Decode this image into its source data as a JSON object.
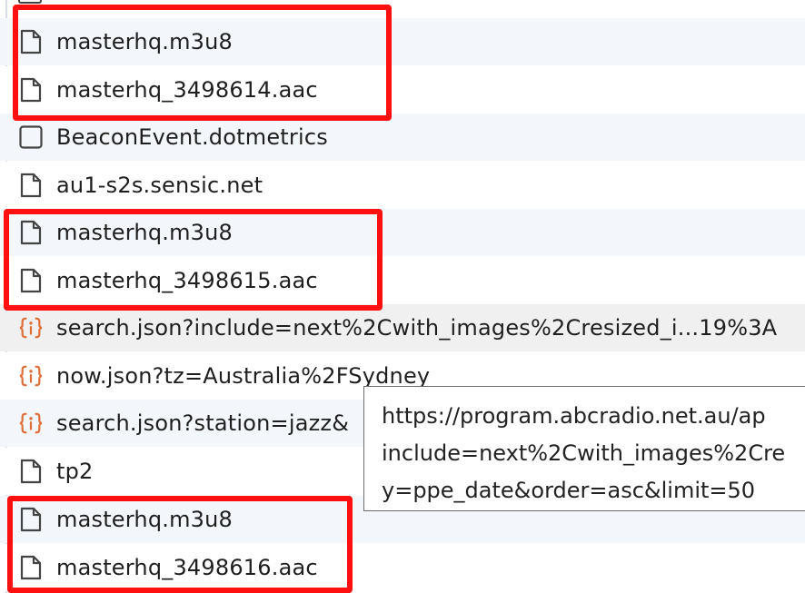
{
  "accent_color": "#ff1010",
  "icon_colors": {
    "file": "#444444",
    "json": "#e0703a"
  },
  "requests": [
    {
      "name": "masterhq.m3u8",
      "icon": "file-icon"
    },
    {
      "name": "masterhq_3498614.aac",
      "icon": "file-icon"
    },
    {
      "name": "BeaconEvent.dotmetrics",
      "icon": "checkbox-icon"
    },
    {
      "name": "au1-s2s.sensic.net",
      "icon": "file-icon"
    },
    {
      "name": "masterhq.m3u8",
      "icon": "file-icon"
    },
    {
      "name": "masterhq_3498615.aac",
      "icon": "file-icon"
    },
    {
      "name": "search.json?include=next%2Cwith_images%2Cresized_i...19%3A",
      "icon": "json-icon"
    },
    {
      "name": "now.json?tz=Australia%2FSydney",
      "icon": "json-icon"
    },
    {
      "name": "search.json?station=jazz&",
      "icon": "json-icon"
    },
    {
      "name": "tp2",
      "icon": "file-icon"
    },
    {
      "name": "masterhq.m3u8",
      "icon": "file-icon"
    },
    {
      "name": "masterhq_3498616.aac",
      "icon": "file-icon"
    }
  ],
  "tooltip": {
    "lines": [
      "https://program.abcradio.net.au/ap",
      "include=next%2Cwith_images%2Cre",
      "y=ppe_date&order=asc&limit=50"
    ]
  }
}
